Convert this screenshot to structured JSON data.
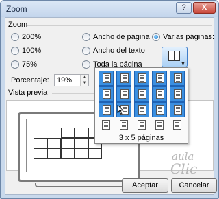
{
  "window": {
    "title": "Zoom",
    "help_label": "?",
    "close_label": "X"
  },
  "zoom_group": {
    "label": "Zoom"
  },
  "zoom_options": {
    "z200": {
      "label": "200%",
      "selected": false
    },
    "z100": {
      "label": "100%",
      "selected": false
    },
    "z75": {
      "label": "75%",
      "selected": false
    },
    "page_width": {
      "label": "Ancho de página",
      "selected": false
    },
    "text_width": {
      "label": "Ancho del texto",
      "selected": false
    },
    "whole_page": {
      "label": "Toda la página",
      "selected": false
    },
    "many_pages": {
      "label": "Varias páginas:",
      "selected": true
    }
  },
  "percentage": {
    "label": "Porcentaje:",
    "value": "19%"
  },
  "preview": {
    "label": "Vista previa"
  },
  "pages_picker": {
    "rows": 4,
    "cols": 5,
    "selected_rows": 3,
    "selected_cols": 5,
    "caption": "3 x 5 páginas"
  },
  "watermark": {
    "line1": "aula",
    "line2": "Clic"
  },
  "buttons": {
    "accept": "Aceptar",
    "cancel": "Cancelar"
  },
  "colors": {
    "selection": "#3b8fe0",
    "selection_border": "#1f63b4",
    "dialog_bg": "#f0f0f0",
    "frame": "#c9d9ec"
  }
}
